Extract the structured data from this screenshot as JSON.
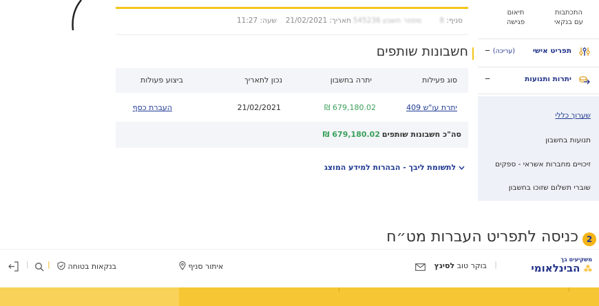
{
  "account_meta": {
    "branch_label": "סניף:",
    "branch_value": "8",
    "account_label": "מספר חשבון",
    "account_value": "545236",
    "date_label": "תאריך:",
    "date_value": "21/02/2021",
    "time_label": "שעה:",
    "time_value": "11:27"
  },
  "section": {
    "title": "חשבונות שותפים"
  },
  "table": {
    "headers": [
      "סוג פעילות",
      "יתרה בחשבון",
      "נכון לתאריך",
      "ביצוע פעולות"
    ],
    "row": {
      "activity": "409 יתרת עו\"ש",
      "balance": "₪ 679,180.02",
      "as_of": "21/02/2021",
      "action": "העברת כסף"
    },
    "total": {
      "label": "סה\"כ חשבונות שותפים",
      "value": "₪ 679,180.02"
    }
  },
  "disclaimer": {
    "label": "לתשומת ליבך - הבהרות למידע המוצג",
    "chevron": "chevron-down-icon"
  },
  "sidebar": {
    "top_items": [
      {
        "label_line1": "התכתבות",
        "label_line2": "עם בנקאי"
      },
      {
        "label_line1": "תיאום",
        "label_line2": "פגישה"
      }
    ],
    "personal_menu": {
      "label": "תפריט אישי",
      "edit": "(עריכה)",
      "toggle": "–",
      "icon": "sliders-icon"
    },
    "balances": {
      "label": "יתרות ותנועות",
      "toggle": "–",
      "icon": "coins-icon"
    },
    "items": [
      "שערוך כללי",
      "תנועות בחשבון",
      "זיכויים מחברות אשראי - ספקים",
      "שוברי תשלום שזוכו בחשבון"
    ]
  },
  "step": {
    "number": "2",
    "title": "כניסה לתפריט העברות מט״ח"
  },
  "header": {
    "logo_small": "משקיעים בך",
    "logo_main": "הבינלאומי",
    "greeting_prefix": "בוקר טוב",
    "greeting_name": "לסיגץ",
    "branch_locator": "איתור סניף",
    "secure_banking": "בנקאות בטוחה"
  },
  "colors": {
    "accent": "#f5c518",
    "link": "#1f3a93",
    "amount": "#3aa05a",
    "menu": "#23348a"
  }
}
